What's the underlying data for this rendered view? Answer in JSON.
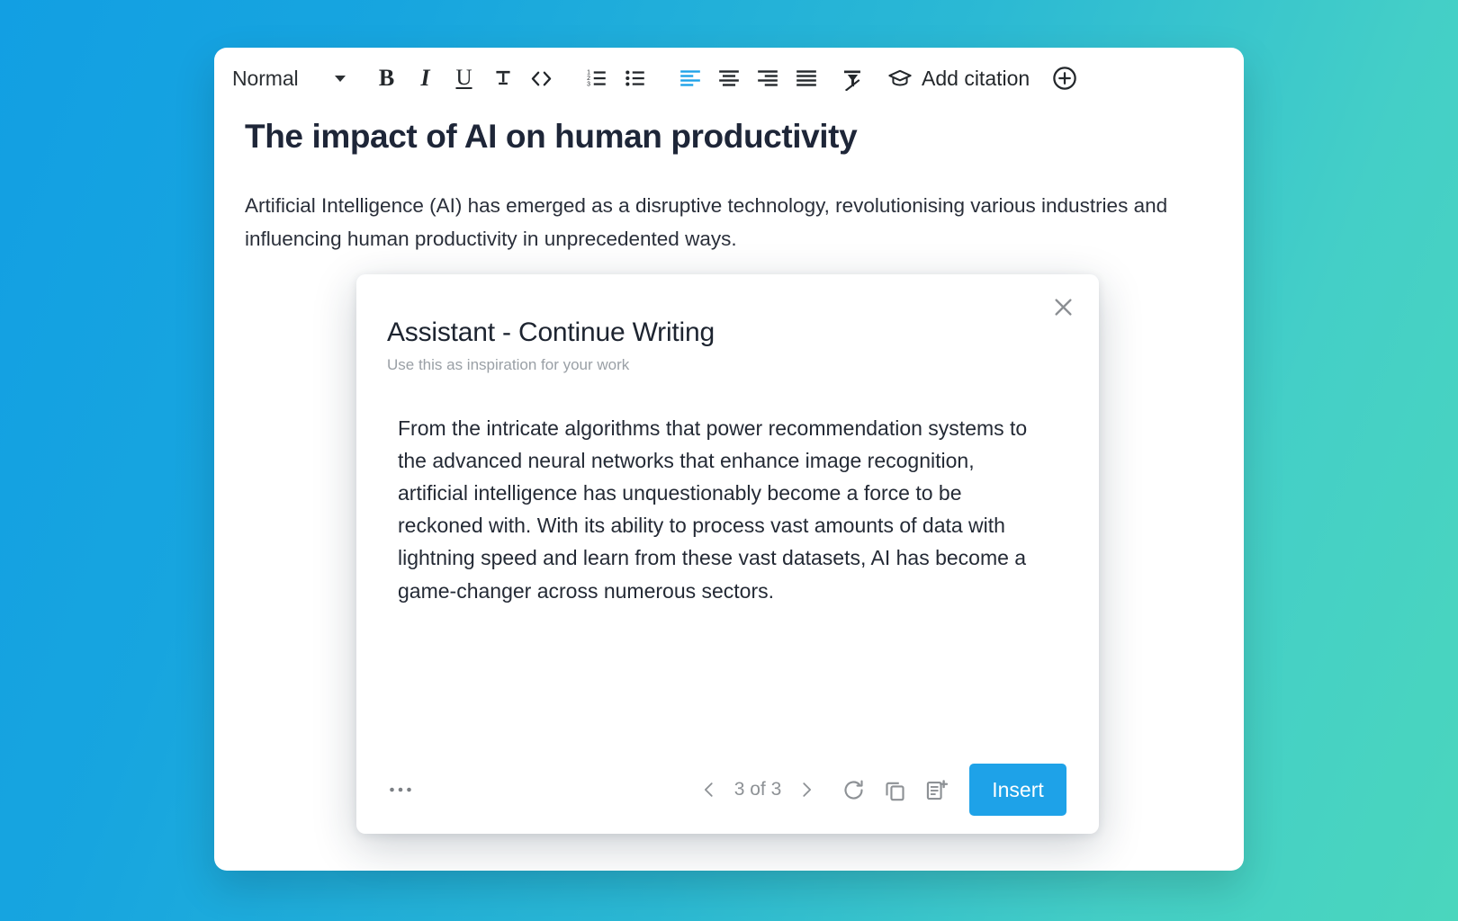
{
  "background": {
    "gradient_from": "#129fe3",
    "gradient_to": "#4ad6bd"
  },
  "toolbar": {
    "style_select": {
      "value": "Normal",
      "caret_icon": "chevron-down-icon"
    },
    "buttons": [
      {
        "name": "bold",
        "label": "B",
        "icon": "bold-icon",
        "active": false
      },
      {
        "name": "italic",
        "label": "I",
        "icon": "italic-icon",
        "active": false
      },
      {
        "name": "underline",
        "label": "U",
        "icon": "underline-icon",
        "active": false
      },
      {
        "name": "strikethrough",
        "label": "",
        "icon": "strikethrough-icon",
        "active": false
      },
      {
        "name": "code-block",
        "label": "<>",
        "icon": "code-icon",
        "active": false
      },
      {
        "name": "ordered-list",
        "label": "",
        "icon": "ordered-list-icon",
        "active": false
      },
      {
        "name": "bullet-list",
        "label": "",
        "icon": "bullet-list-icon",
        "active": false
      },
      {
        "name": "align-left",
        "label": "",
        "icon": "align-left-icon",
        "active": true
      },
      {
        "name": "align-center",
        "label": "",
        "icon": "align-center-icon",
        "active": false
      },
      {
        "name": "align-right",
        "label": "",
        "icon": "align-right-icon",
        "active": false
      },
      {
        "name": "align-justify",
        "label": "",
        "icon": "align-justify-icon",
        "active": false
      },
      {
        "name": "clear-formatting",
        "label": "",
        "icon": "clear-formatting-icon",
        "active": false
      }
    ],
    "citation": {
      "label": "Add citation",
      "icon": "graduation-cap-icon"
    },
    "add_button": {
      "icon": "plus-circle-icon"
    },
    "active_color": "#1ea2e8"
  },
  "document": {
    "title": "The impact of AI on human productivity",
    "paragraph": "Artificial Intelligence (AI) has emerged as a disruptive technology, revolutionising various industries and influencing human productivity in unprecedented ways."
  },
  "modal": {
    "title": "Assistant - Continue Writing",
    "subtitle": "Use this as inspiration for your work",
    "close_icon": "close-icon",
    "body_text": "From the intricate algorithms that power recommendation systems to the advanced neural networks that enhance image recognition, artificial intelligence has unquestionably become a force to be reckoned with. With its ability to process vast amounts of data with lightning speed and learn from these vast datasets, AI has become a game-changer across numerous sectors.",
    "footer": {
      "more_label": "•••",
      "more_icon": "ellipsis-icon",
      "prev_icon": "chevron-left-icon",
      "next_icon": "chevron-right-icon",
      "pagination_label": "3 of 3",
      "current_page": 3,
      "total_pages": 3,
      "regenerate_icon": "refresh-icon",
      "copy_icon": "copy-icon",
      "insert-document_icon": "document-plus-icon",
      "insert_label": "Insert",
      "insert_color": "#1ea2e8"
    }
  }
}
